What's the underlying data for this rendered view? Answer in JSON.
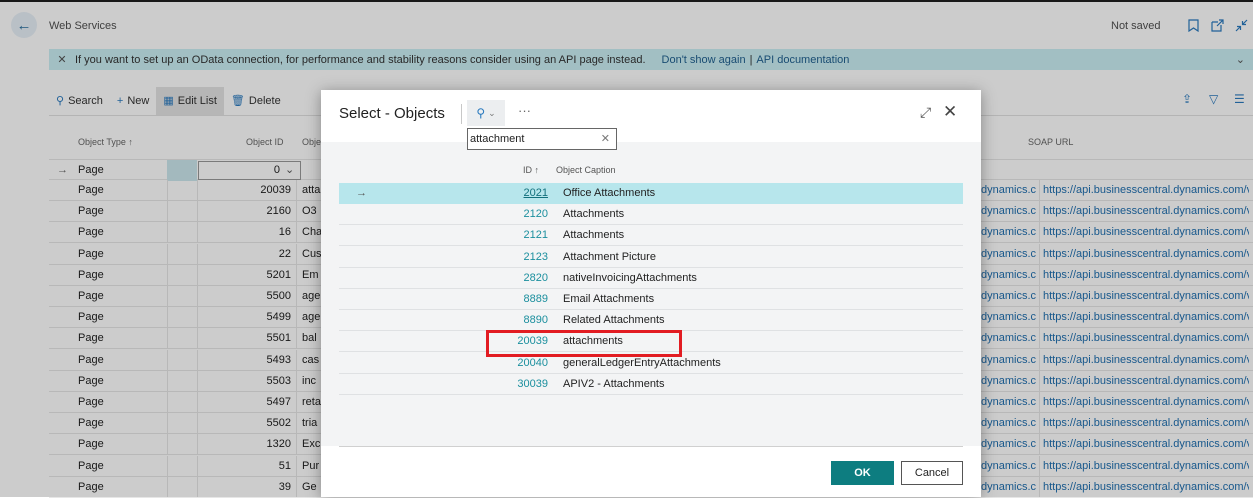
{
  "header": {
    "title": "Web Services",
    "status": "Not saved",
    "back_icon": "arrow-left-icon",
    "icons": [
      "bookmark-icon",
      "open-new-window-icon",
      "collapse-icon"
    ]
  },
  "banner": {
    "message": "If you want to set up an OData connection, for performance and stability reasons consider using an API page instead.",
    "dont_show": "Don't show again",
    "separator": "|",
    "api_doc": "API documentation"
  },
  "toolbar": {
    "search": "Search",
    "new": "New",
    "edit_list": "Edit List",
    "delete": "Delete"
  },
  "grid": {
    "columns": {
      "object_type": "Object Type ↑",
      "object_id": "Object ID",
      "object_name": "Obje",
      "soap_url": "SOAP URL"
    },
    "edit_row": {
      "type": "Page",
      "id": "0"
    },
    "rows": [
      {
        "type": "Page",
        "id": "20039",
        "name": "atta",
        "odata": "dynamics.co...",
        "soap": "https://api.businesscentral.dynamics.com/v..."
      },
      {
        "type": "Page",
        "id": "2160",
        "name": "O3",
        "odata": "dynamics.co...",
        "soap": "https://api.businesscentral.dynamics.com/v..."
      },
      {
        "type": "Page",
        "id": "16",
        "name": "Cha",
        "odata": "dynamics.co...",
        "soap": "https://api.businesscentral.dynamics.com/v..."
      },
      {
        "type": "Page",
        "id": "22",
        "name": "Cus",
        "odata": "dynamics.co...",
        "soap": "https://api.businesscentral.dynamics.com/v..."
      },
      {
        "type": "Page",
        "id": "5201",
        "name": "Em",
        "odata": "dynamics.co...",
        "soap": "https://api.businesscentral.dynamics.com/v..."
      },
      {
        "type": "Page",
        "id": "5500",
        "name": "age",
        "odata": "dynamics.co...",
        "soap": "https://api.businesscentral.dynamics.com/v..."
      },
      {
        "type": "Page",
        "id": "5499",
        "name": "age",
        "odata": "dynamics.co...",
        "soap": "https://api.businesscentral.dynamics.com/v..."
      },
      {
        "type": "Page",
        "id": "5501",
        "name": "bal",
        "odata": "dynamics.co...",
        "soap": "https://api.businesscentral.dynamics.com/v..."
      },
      {
        "type": "Page",
        "id": "5493",
        "name": "cas",
        "odata": "dynamics.co...",
        "soap": "https://api.businesscentral.dynamics.com/v..."
      },
      {
        "type": "Page",
        "id": "5503",
        "name": "inc",
        "odata": "dynamics.co...",
        "soap": "https://api.businesscentral.dynamics.com/v..."
      },
      {
        "type": "Page",
        "id": "5497",
        "name": "reta",
        "odata": "dynamics.co...",
        "soap": "https://api.businesscentral.dynamics.com/v..."
      },
      {
        "type": "Page",
        "id": "5502",
        "name": "tria",
        "odata": "dynamics.co...",
        "soap": "https://api.businesscentral.dynamics.com/v..."
      },
      {
        "type": "Page",
        "id": "1320",
        "name": "Exc",
        "odata": "dynamics.co...",
        "soap": "https://api.businesscentral.dynamics.com/v..."
      },
      {
        "type": "Page",
        "id": "51",
        "name": "Pur",
        "odata": "dynamics.co...",
        "soap": "https://api.businesscentral.dynamics.com/v..."
      },
      {
        "type": "Page",
        "id": "39",
        "name": "Ge",
        "odata": "dynamics.co...",
        "soap": "https://api.businesscentral.dynamics.com/v..."
      }
    ]
  },
  "dialog": {
    "title": "Select - Objects",
    "more": "···",
    "search_value": "attachment",
    "col_id": "ID ↑",
    "col_caption": "Object Caption",
    "rows": [
      {
        "id": "2021",
        "caption": "Office Attachments",
        "selected": true
      },
      {
        "id": "2120",
        "caption": "Attachments"
      },
      {
        "id": "2121",
        "caption": "Attachments"
      },
      {
        "id": "2123",
        "caption": "Attachment Picture"
      },
      {
        "id": "2820",
        "caption": "nativeInvoicingAttachments"
      },
      {
        "id": "8889",
        "caption": "Email Attachments"
      },
      {
        "id": "8890",
        "caption": "Related Attachments"
      },
      {
        "id": "20039",
        "caption": "attachments",
        "highlighted": true
      },
      {
        "id": "20040",
        "caption": "generalLedgerEntryAttachments"
      },
      {
        "id": "30039",
        "caption": "APIV2 - Attachments"
      }
    ],
    "ok": "OK",
    "cancel": "Cancel"
  },
  "colors": {
    "accent": "#0d7d80",
    "link": "#1f6fb0",
    "highlight": "#e21c22",
    "selected_row": "#b7e6ec",
    "banner": "#cbeff4"
  }
}
